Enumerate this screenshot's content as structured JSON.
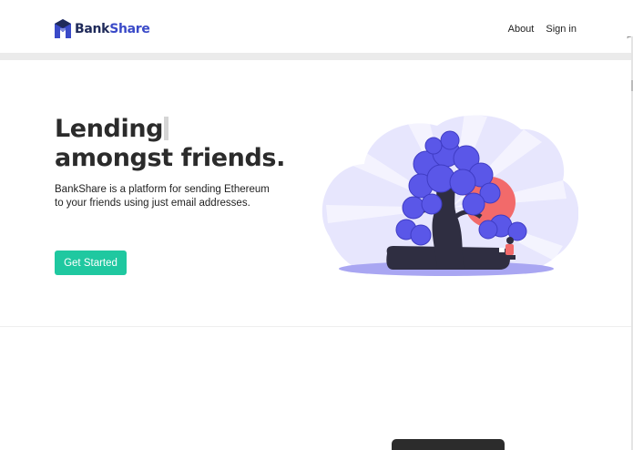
{
  "brand": {
    "name_part1": "Bank",
    "name_part2": "Share",
    "color_dark": "#1f2a5a",
    "color_accent": "#3a4ac8"
  },
  "nav": {
    "items": [
      {
        "label": "About"
      },
      {
        "label": "Sign in"
      }
    ]
  },
  "hero": {
    "headline_line1": "Lending",
    "headline_line2": "amongst friends.",
    "subtitle": "BankShare is a platform for sending Ethereum to your friends using just email addresses.",
    "cta_label": "Get Started",
    "cta_color": "#1fc8a0"
  },
  "illustration": {
    "icon": "tree-with-person-reading-illustration",
    "primary_color": "#5a57e8",
    "sun_color": "#f26a6a",
    "cloud_color": "#e6e6ff"
  }
}
